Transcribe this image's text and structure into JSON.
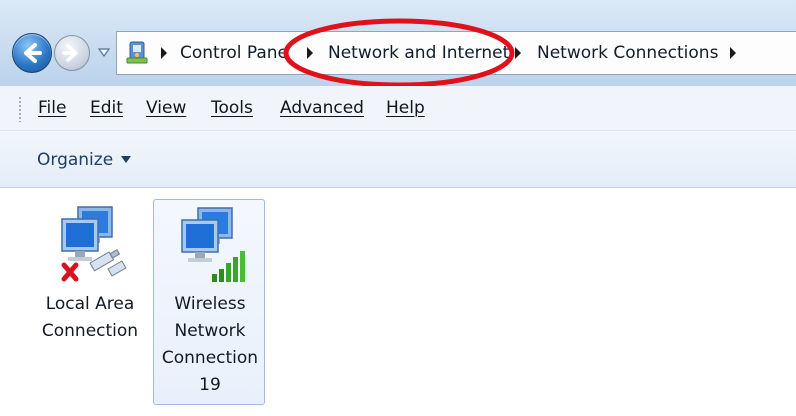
{
  "address_bar": {
    "breadcrumbs": [
      "Control Pane",
      "Network and Internet",
      "Network Connections"
    ],
    "highlight_color": "#e0111b"
  },
  "menu": {
    "items": [
      "File",
      "Edit",
      "View",
      "Tools",
      "Advanced",
      "Help"
    ]
  },
  "command_bar": {
    "organize_label": "Organize"
  },
  "connections": [
    {
      "label": "Local Area Connection",
      "status": "disconnected",
      "icon": "wired-network-disconnected-icon"
    },
    {
      "label": "Wireless Network Connection 19",
      "status": "connected",
      "icon": "wireless-network-signal-icon",
      "selected": true
    }
  ]
}
